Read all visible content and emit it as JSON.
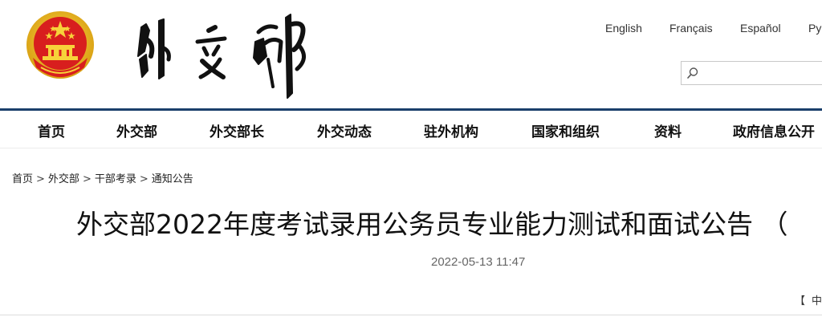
{
  "header": {
    "emblem_icon": "national-emblem-icon",
    "calligraphy": "外交部",
    "languages": [
      "English",
      "Français",
      "Español",
      "Ру"
    ],
    "search": {
      "placeholder": "",
      "value": "",
      "icon": "search-icon"
    }
  },
  "colors": {
    "nav_divider": "#1a3f6b",
    "emblem_red": "#d81e1e",
    "emblem_gold": "#f2c021"
  },
  "nav": {
    "items": [
      "首页",
      "外交部",
      "外交部长",
      "外交动态",
      "驻外机构",
      "国家和组织",
      "资料",
      "政府信息公开"
    ]
  },
  "breadcrumb": {
    "items": [
      "首页",
      "外交部",
      "干部考录",
      "通知公告"
    ],
    "separator": ">"
  },
  "article": {
    "title": "外交部2022年度考试录用公务员专业能力测试和面试公告 （",
    "date": "2022-05-13 11:47",
    "font_size_bracket": "【",
    "font_size_option": "中"
  }
}
